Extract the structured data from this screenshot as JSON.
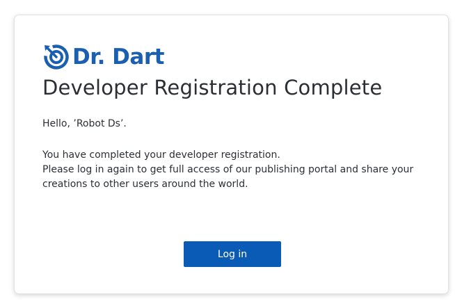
{
  "brand": {
    "name": "Dr. Dart",
    "color": "#1a5fb0"
  },
  "page": {
    "title": "Developer Registration Complete",
    "greeting": "Hello, ’Robot Ds’.",
    "message_lines": [
      "You have completed your developer registration.",
      "Please log in again to get full access of our publishing portal and share your creations to other users around the world."
    ]
  },
  "actions": {
    "login_label": "Log in",
    "login_color": "#0a5bb5"
  }
}
